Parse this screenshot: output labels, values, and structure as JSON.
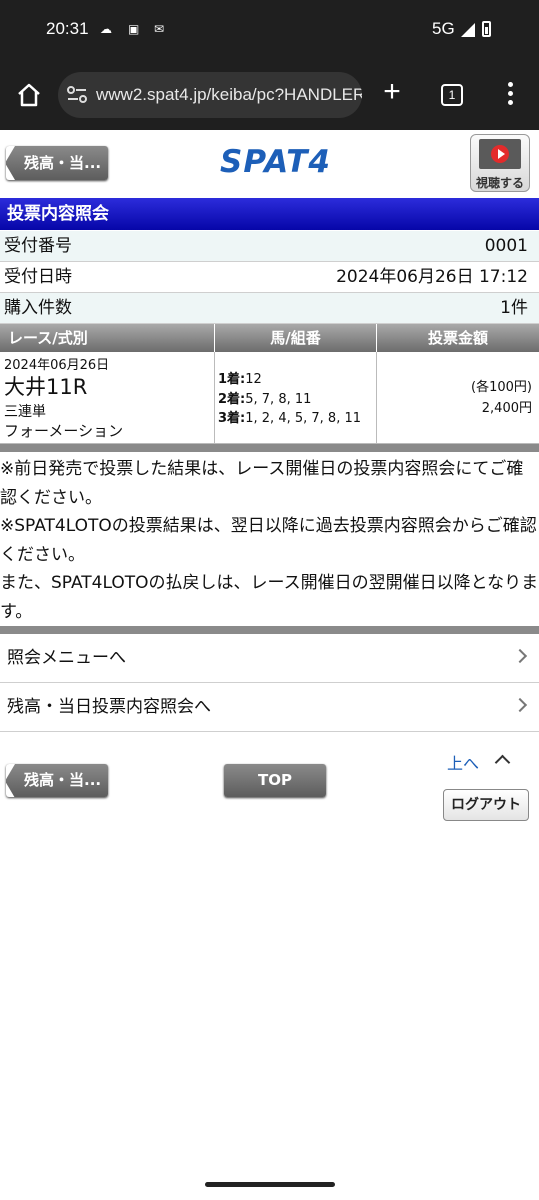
{
  "status_bar": {
    "time": "20:31",
    "network": "5G"
  },
  "browser": {
    "url": "www2.spat4.jp/keiba/pc?HANDLER=",
    "tab_count": "1"
  },
  "header": {
    "back_label": "残高・当...",
    "logo": "SPAT4",
    "view_label": "視聴する"
  },
  "page_title": "投票内容照会",
  "info": {
    "receipt_no_label": "受付番号",
    "receipt_no": "0001",
    "receipt_time_label": "受付日時",
    "receipt_time": "2024年06月26日 17:12",
    "count_label": "購入件数",
    "count": "1件"
  },
  "table": {
    "headers": [
      "レース/式別",
      "馬/組番",
      "投票金額"
    ],
    "race_date": "2024年06月26日",
    "race_name": "大井11R",
    "bet_type": "三連単",
    "bet_method": "フォーメーション",
    "picks": [
      {
        "pos": "1着:",
        "horses": "12"
      },
      {
        "pos": "2着:",
        "horses": "5, 7, 8, 11"
      },
      {
        "pos": "3着:",
        "horses": "1, 2, 4, 5, 7, 8, 11"
      }
    ],
    "each_amount": "(各100円)",
    "total_amount": "2,400円"
  },
  "notes": [
    "※前日発売で投票した結果は、レース開催日の投票内容照会にてご確認ください。",
    "※SPAT4LOTOの投票結果は、翌日以降に過去投票内容照会からご確認ください。",
    "また、SPAT4LOTOの払戻しは、レース開催日の翌開催日以降となります。"
  ],
  "menu": {
    "inquiry_menu": "照会メニューへ",
    "balance_inquiry": "残高・当日投票内容照会へ"
  },
  "footer": {
    "back_label": "残高・当...",
    "top_label": "TOP",
    "up_label": "上へ",
    "logout_label": "ログアウト"
  }
}
